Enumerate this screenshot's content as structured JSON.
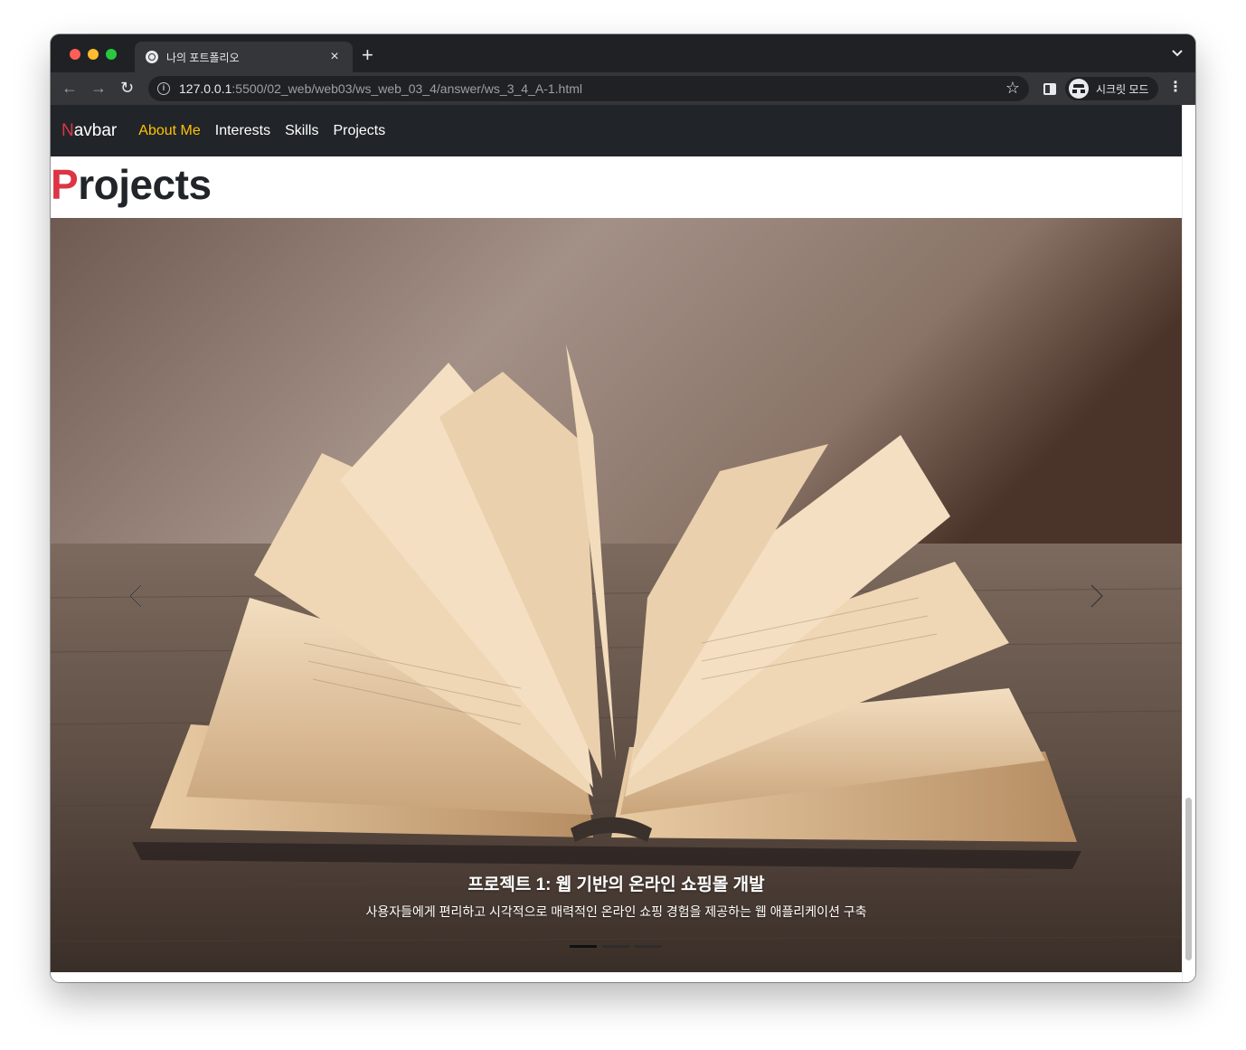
{
  "browser": {
    "tab_title": "나의 포트폴리오",
    "tab_close": "×",
    "new_tab": "+",
    "tab_list": "⌄",
    "url_host": "127.0.0.1",
    "url_path": ":5500/02_web/web03/ws_web_03_4/answer/ws_3_4_A-1.html",
    "incognito_label": "시크릿 모드",
    "back": "←",
    "forward": "→",
    "reload": "↻",
    "star": "☆",
    "menu": "⋮",
    "info": "i"
  },
  "navbar": {
    "brand_first": "N",
    "brand_rest": "avbar",
    "links": [
      {
        "label": "About Me",
        "active": true
      },
      {
        "label": "Interests",
        "active": false
      },
      {
        "label": "Skills",
        "active": false
      },
      {
        "label": "Projects",
        "active": false
      }
    ]
  },
  "section": {
    "title_first": "P",
    "title_rest": "rojects"
  },
  "carousel": {
    "caption_title": "프로젝트 1: 웹 기반의 온라인 쇼핑몰 개발",
    "caption_text": "사용자들에게 편리하고 시각적으로 매력적인 온라인 쇼핑 경험을 제공하는 웹 애플리케이션 구축",
    "slide_count": 3,
    "active_index": 0,
    "image_subject": "open-book-on-wooden-table"
  },
  "colors": {
    "accent_red": "#dc3545",
    "active_link": "#ffc107",
    "navbar_bg": "#212529"
  }
}
